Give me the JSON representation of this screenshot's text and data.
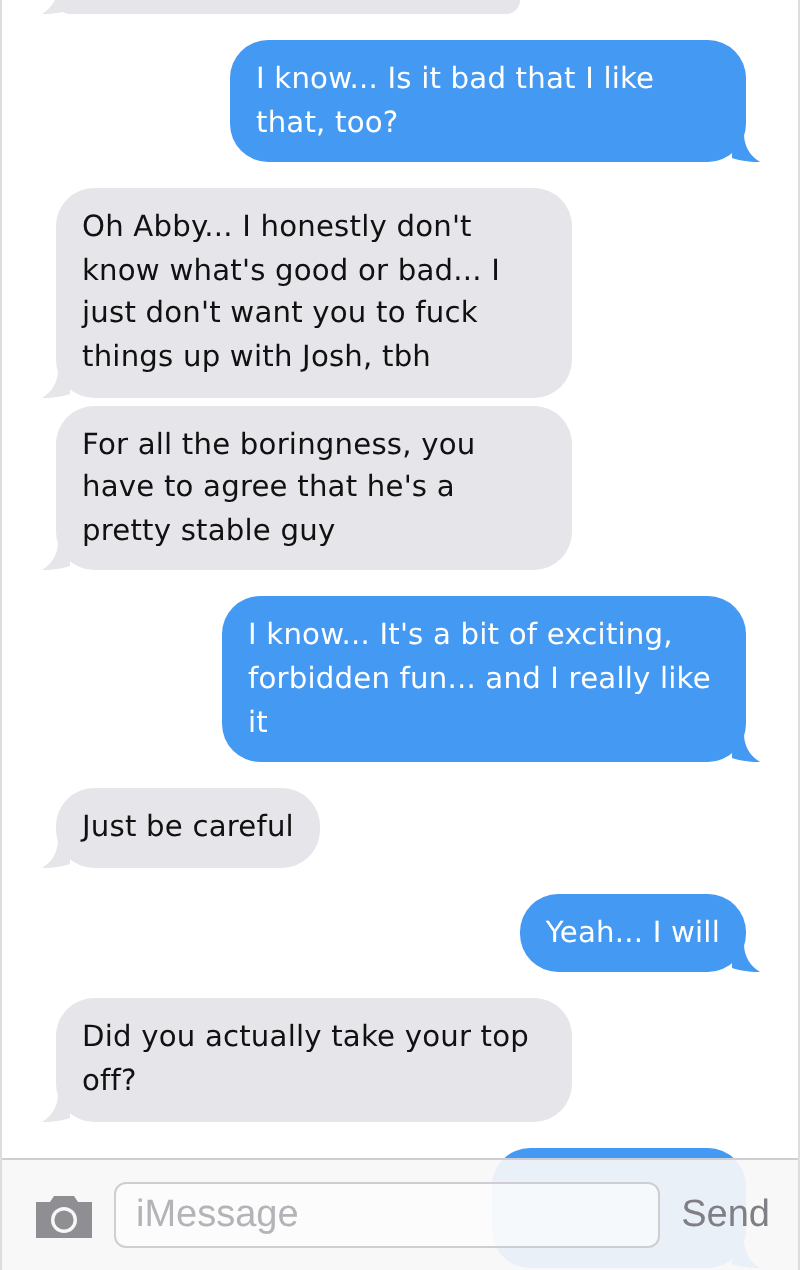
{
  "messages": [
    {
      "kind": "received",
      "partial": true
    },
    {
      "kind": "sent",
      "partial": false,
      "text": "I know... Is it bad that I like that, too?"
    },
    {
      "kind": "received",
      "partial": false,
      "text": "Oh Abby... I honestly don't know what's good or bad... I just don't want you to fuck things up with Josh, tbh"
    },
    {
      "kind": "received",
      "partial": false,
      "text": "For all the boringness, you have to agree that he's a pretty stable guy"
    },
    {
      "kind": "sent",
      "partial": false,
      "text": "I know... It's a bit of exciting, forbidden fun... and I really like it"
    },
    {
      "kind": "received",
      "partial": false,
      "text": "Just be careful"
    },
    {
      "kind": "sent",
      "partial": false,
      "text": "Yeah... I will"
    },
    {
      "kind": "received",
      "partial": false,
      "text": "Did you actually take your top off?"
    },
    {
      "kind": "sent",
      "partial": true
    }
  ],
  "composer": {
    "placeholder": "iMessage",
    "send": "Send"
  }
}
